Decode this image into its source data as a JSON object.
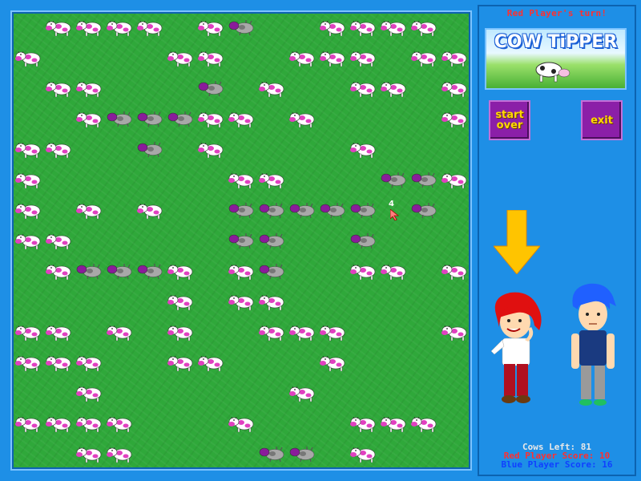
{
  "game": {
    "turn_text": "Red Player's turn!",
    "logo_text": "COW TiPPER",
    "start_label_1": "start",
    "start_label_2": "over",
    "exit_label": "exit",
    "stats": {
      "cows_left": "Cows Left: 81",
      "red_score": "Red Player Score: 10",
      "blue_score": "Blue Player Score: 16"
    },
    "selected_number": "4",
    "active_player": "red",
    "colors": {
      "field": "#2fa83a",
      "frame": "#1e8fe6",
      "cow_spots": "#e040c0",
      "tipped_cow": "#9a9a9a",
      "button": "#8b1fa8",
      "button_text": "#ffd800",
      "arrow": "#ffc400",
      "red_player": "#ff3030",
      "blue_player": "#1040ff"
    }
  },
  "board": {
    "rows": [
      "_cccc_cT__cccc__",
      "c____cc__ccc_cc",
      "_cc___T_c__cc_c_",
      "__cTTTcc_c____c_",
      "cc__T_c____c___cc",
      "c______cc___TTc",
      "c_c_c__TTTTT_T__",
      "cc_____TT__T_____c",
      "_cTTTc_cT__cc_cc",
      "_____c_cc______c",
      "cc_c_c__ccc___c",
      "ccc__cc___c_____",
      "__c______c______c_",
      "cccc___c___ccc_",
      "__cc____TT_c___c"
    ]
  }
}
